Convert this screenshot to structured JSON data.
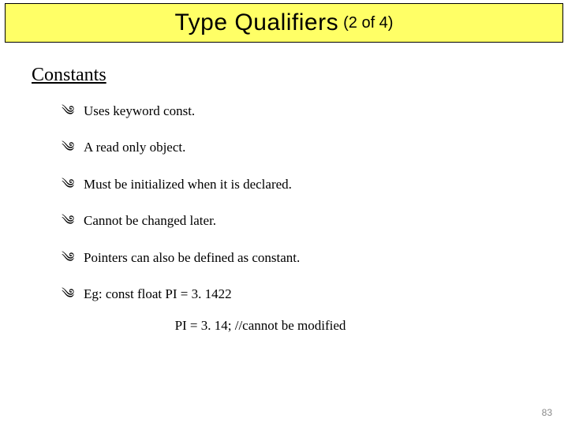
{
  "title": {
    "main": "Type Qualifiers",
    "sub": "(2 of 4)"
  },
  "section_heading": "Constants",
  "bullet_glyph": "༄",
  "bullets": [
    "Uses keyword const.",
    "A  read only object.",
    "Must be initialized when it is declared.",
    "Cannot be changed later.",
    "Pointers can also be defined as constant.",
    "Eg: const float PI = 3. 1422"
  ],
  "note": "PI = 3. 14; //cannot be modified",
  "page_number": "83"
}
